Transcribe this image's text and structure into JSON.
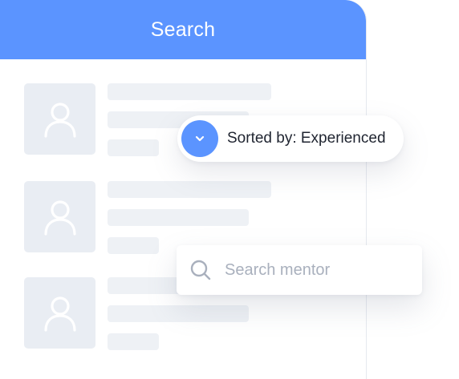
{
  "header": {
    "title": "Search"
  },
  "sort": {
    "label": "Sorted by: Experienced"
  },
  "search": {
    "placeholder": "Search mentor",
    "value": ""
  },
  "results": {
    "rows": 3,
    "avatar_icon": "user-icon"
  },
  "colors": {
    "accent": "#5b94ff",
    "placeholder_block": "#eef1f5",
    "avatar_bg": "#e9edf3",
    "text": "#1f2430",
    "placeholder_text": "#a9b0bd"
  },
  "icons": {
    "sort_toggle": "chevron-down-icon",
    "search": "search-icon"
  }
}
